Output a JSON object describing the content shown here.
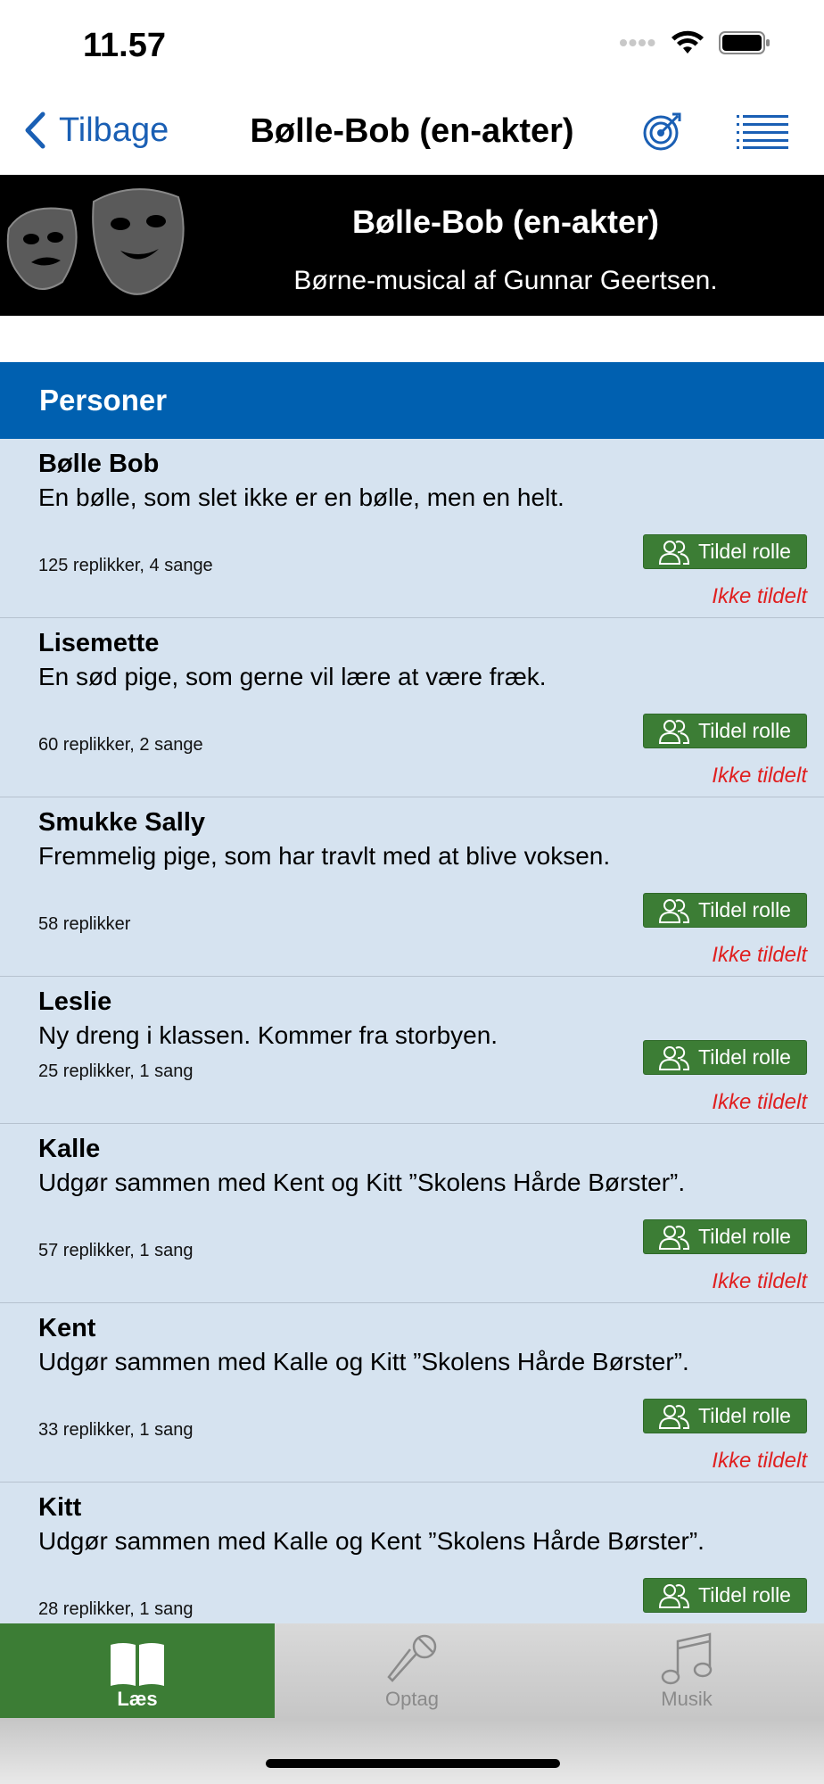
{
  "status_bar": {
    "time": "11.57"
  },
  "nav": {
    "back_label": "Tilbage",
    "title": "Bølle-Bob (en-akter)"
  },
  "banner": {
    "title": "Bølle-Bob (en-akter)",
    "subtitle": "Børne-musical af Gunnar Geertsen."
  },
  "section": {
    "title": "Personer"
  },
  "roles": [
    {
      "name": "Bølle Bob",
      "description": "En bølle, som slet ikke er en bølle, men en helt.",
      "stats": "125 replikker, 4 sange",
      "button": "Tildel rolle",
      "status": "Ikke tildelt"
    },
    {
      "name": "Lisemette",
      "description": "En sød pige, som gerne vil lære at være fræk.",
      "stats": "60 replikker, 2 sange",
      "button": "Tildel rolle",
      "status": "Ikke tildelt"
    },
    {
      "name": "Smukke Sally",
      "description": "Fremmelig pige, som har travlt med at blive voksen.",
      "stats": "58 replikker",
      "button": "Tildel rolle",
      "status": "Ikke tildelt"
    },
    {
      "name": "Leslie",
      "description": "Ny dreng i klassen. Kommer fra storbyen.",
      "stats": "25 replikker, 1 sang",
      "button": "Tildel rolle",
      "status": "Ikke tildelt"
    },
    {
      "name": "Kalle",
      "description": "Udgør sammen med Kent og Kitt ”Skolens Hårde Børster”.",
      "stats": "57 replikker, 1 sang",
      "button": "Tildel rolle",
      "status": "Ikke tildelt"
    },
    {
      "name": "Kent",
      "description": "Udgør sammen med Kalle og Kitt ”Skolens Hårde Børster”.",
      "stats": "33 replikker, 1 sang",
      "button": "Tildel rolle",
      "status": "Ikke tildelt"
    },
    {
      "name": "Kitt",
      "description": "Udgør sammen med Kalle og Kent ”Skolens Hårde Børster”.",
      "stats": "28 replikker, 1 sang",
      "button": "Tildel rolle",
      "status": ""
    }
  ],
  "tabs": [
    {
      "label": "Læs",
      "icon": "book-icon",
      "active": true
    },
    {
      "label": "Optag",
      "icon": "microphone-icon",
      "active": false
    },
    {
      "label": "Musik",
      "icon": "music-note-icon",
      "active": false
    }
  ],
  "colors": {
    "accent_blue": "#0060b0",
    "green": "#3c7d35",
    "list_bg": "#d6e3f0",
    "unassigned_red": "#e02020"
  }
}
